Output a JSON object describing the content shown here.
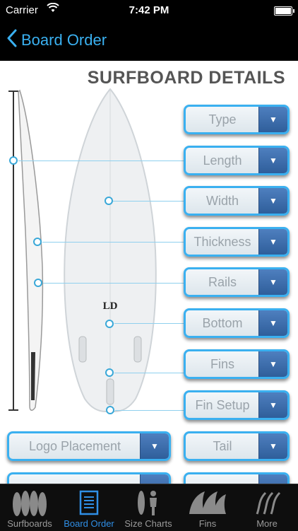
{
  "status_bar": {
    "carrier": "Carrier",
    "time": "7:42 PM"
  },
  "nav": {
    "back_label": "Board Order"
  },
  "page": {
    "title": "SURFBOARD DETAILS"
  },
  "board": {
    "logo_text": "LD"
  },
  "dropdowns": {
    "type": "Type",
    "length": "Length",
    "width": "Width",
    "thickness": "Thickness",
    "rails": "Rails",
    "bottom": "Bottom",
    "fins": "Fins",
    "fin_setup": "Fin Setup",
    "logo_placement": "Logo Placement",
    "tail": "Tail"
  },
  "tabs": [
    {
      "label": "Surfboards",
      "icon": "surfboards-icon"
    },
    {
      "label": "Board Order",
      "icon": "board-order-icon"
    },
    {
      "label": "Size Charts",
      "icon": "size-charts-icon"
    },
    {
      "label": "Fins",
      "icon": "fins-icon"
    },
    {
      "label": "More",
      "icon": "more-icon"
    }
  ],
  "colors": {
    "accent": "#3ab0f0",
    "dropdown_button": "#3a6cae",
    "active_tab": "#2f8fe6"
  }
}
